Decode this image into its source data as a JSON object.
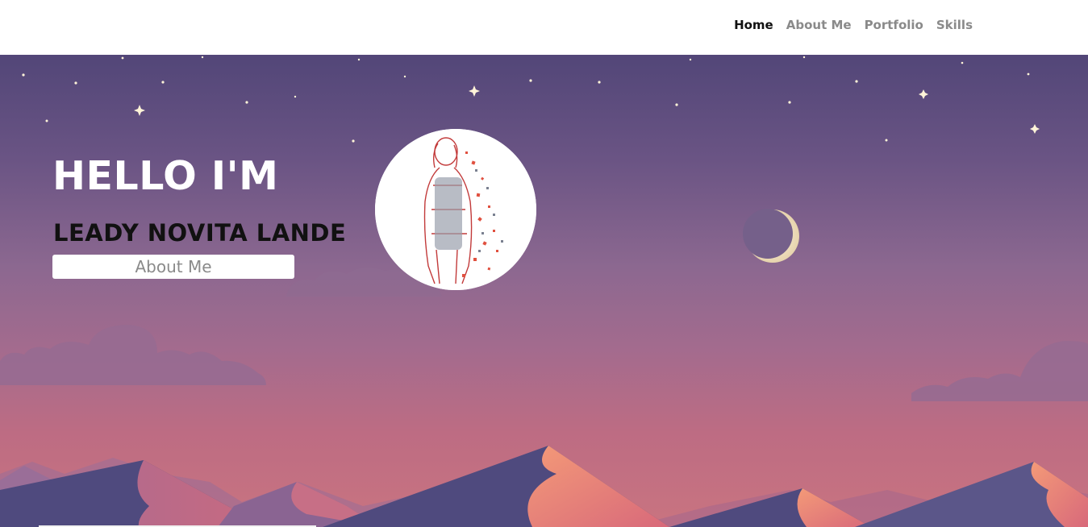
{
  "nav": {
    "items": [
      {
        "label": "Home",
        "active": true
      },
      {
        "label": "About Me",
        "active": false
      },
      {
        "label": "Portfolio",
        "active": false
      },
      {
        "label": "Skills",
        "active": false
      }
    ]
  },
  "hero": {
    "greeting": "HELLO I'M",
    "name": "LEADY NOVITA LANDE",
    "cta_label": "About Me",
    "avatar_icon": "portrait-sketch",
    "decor_icons": [
      "star-icon",
      "crescent-moon-icon",
      "cloud-icon",
      "mountain-icon"
    ]
  },
  "colors": {
    "sky_top": "#524678",
    "sky_bottom": "#c97480",
    "nav_active": "#111111",
    "nav_inactive": "#8a8a8a",
    "moon": "#f1e3c2",
    "dune_dark": "#4f4a7e",
    "dune_light": "#f0826a"
  }
}
